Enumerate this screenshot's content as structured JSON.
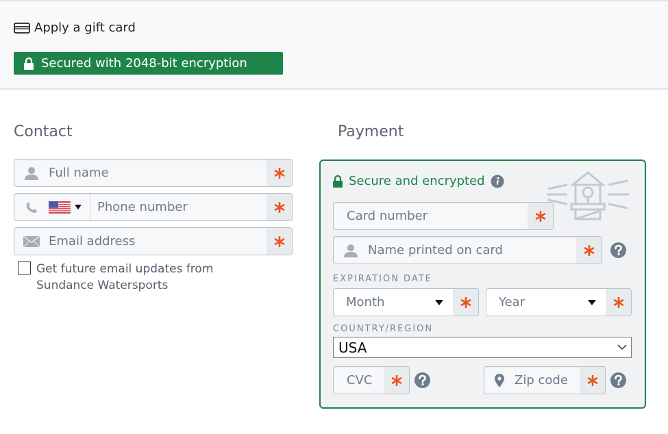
{
  "header": {
    "gift_card_label": "Apply a gift card",
    "gift_card_icon": "credit-card-icon",
    "security_badge": "Secured with 2048-bit encryption",
    "security_icon": "lock-icon"
  },
  "contact": {
    "title": "Contact",
    "full_name": {
      "placeholder": "Full name",
      "icon": "user-icon",
      "required": true
    },
    "phone": {
      "placeholder": "Phone number",
      "icon": "phone-icon",
      "country_flag": "US",
      "required": true
    },
    "email": {
      "placeholder": "Email address",
      "icon": "envelope-icon",
      "required": true
    },
    "newsletter": {
      "label": "Get future email updates from Sundance Watersports",
      "checked": false
    }
  },
  "payment": {
    "title": "Payment",
    "secure_text": "Secure and encrypted",
    "card_number": {
      "placeholder": "Card number",
      "required": true
    },
    "name_on_card": {
      "placeholder": "Name printed on card",
      "icon": "user-icon",
      "required": true
    },
    "expiration_label": "EXPIRATION DATE",
    "month": {
      "placeholder": "Month",
      "required": true
    },
    "year": {
      "placeholder": "Year",
      "required": true
    },
    "country_label": "COUNTRY/REGION",
    "country": {
      "value": "USA"
    },
    "cvc": {
      "placeholder": "CVC",
      "required": true
    },
    "zip": {
      "placeholder": "Zip code",
      "icon": "map-pin-icon",
      "required": true
    }
  },
  "colors": {
    "accent_green": "#1f8449",
    "required_orange": "#e8561c",
    "panel_bg": "#f0f2f4"
  }
}
